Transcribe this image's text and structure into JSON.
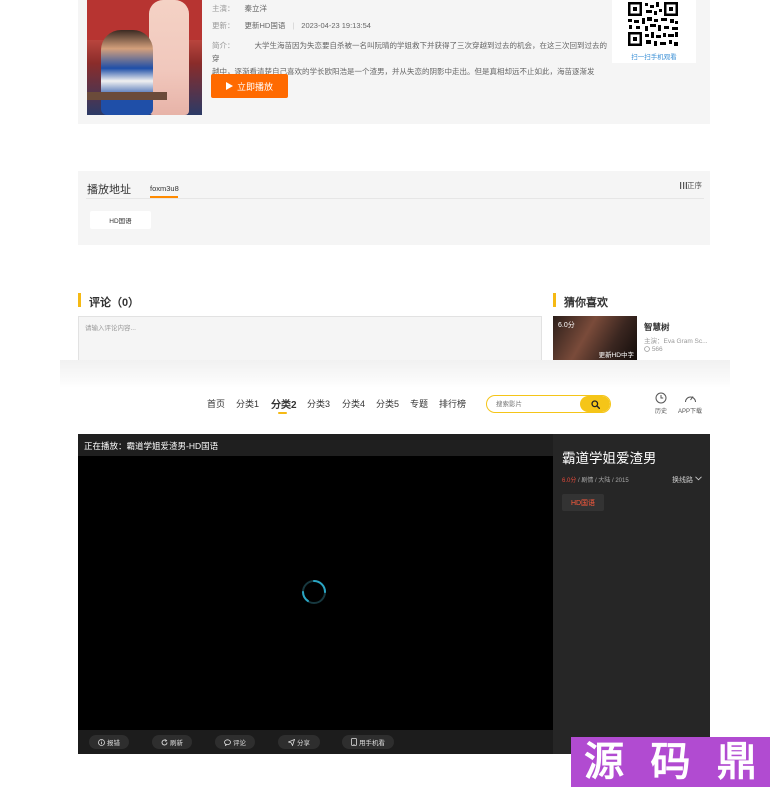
{
  "detail": {
    "cast_label": "主演：",
    "cast_value": "秦立洋",
    "update_label": "更新：",
    "update_value": "更新HD国语",
    "update_time": "2023-04-23 19:13:54",
    "intro_label": "简介：",
    "intro_line1": "大学生海苗因为失恋要自杀被一名叫阮晴的学姐救下并获得了三次穿越到过去的机会，在这三次回到过去的穿",
    "intro_line2": "越中，逐渐看清楚自己喜欢的学长欧阳浩是一个渣男，并从失恋的阴影中走出。但是真相却远不止如此，海苗逐渐发现...",
    "play_button": "立即播放",
    "qr_caption": "扫一扫手机观看"
  },
  "playlist": {
    "title": "播放地址",
    "source_tab": "foxm3u8",
    "sort_label": "正序",
    "episodes": [
      "HD国语"
    ]
  },
  "comments": {
    "title": "评论（0）",
    "placeholder": "请输入评论内容..."
  },
  "recommend": {
    "title": "猜你喜欢",
    "items": [
      {
        "score": "6.0分",
        "badge": "更新HD中字",
        "name": "智慧树",
        "cast": "主演：Eva Gram Sc...",
        "views": "566"
      }
    ]
  },
  "nav": {
    "items": [
      "首页",
      "分类1",
      "分类2",
      "分类3",
      "分类4",
      "分类5",
      "专题",
      "排行榜"
    ],
    "active_index": 2,
    "search_placeholder": "搜索影片",
    "history_label": "历史",
    "app_label": "APP下载"
  },
  "player": {
    "now_playing": "正在播放：霸道学姐爱渣男-HD国语",
    "controls": [
      "报错",
      "刷新",
      "评论",
      "分享",
      "用手机看"
    ]
  },
  "sidebar": {
    "title": "霸道学姐爱渣男",
    "score": "6.0分",
    "meta": " / 剧情 / 大陆 / 2015",
    "switch_line": "换线路",
    "episode": "HD国语"
  },
  "watermark": {
    "chars": [
      "源",
      "码",
      "鼎"
    ]
  },
  "colors": {
    "accent_orange": "#ff6a00",
    "accent_yellow": "#f5c518",
    "watermark_purple": "#b14bd1"
  }
}
